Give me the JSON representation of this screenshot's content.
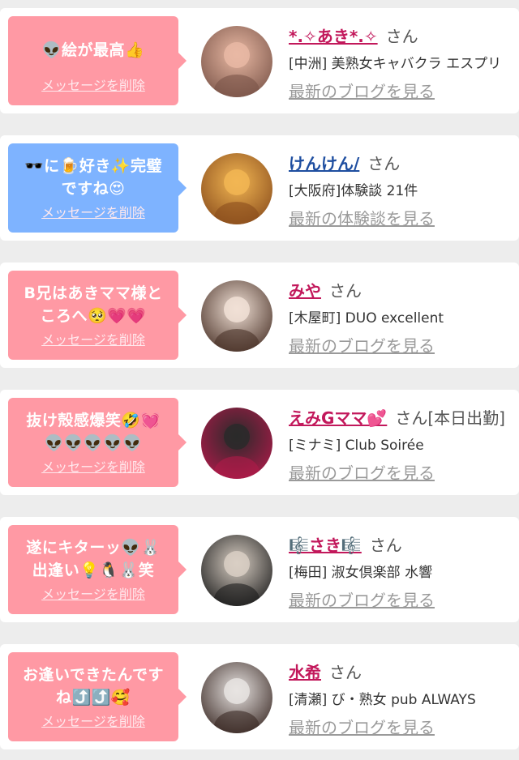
{
  "entries": [
    {
      "message": "👽絵が最高👍",
      "delete_label": "メッセージを削除",
      "bubble_color": "#ff99a4",
      "name": "*.✧あき*.✧",
      "name_color": "#c2185b",
      "honorific": "さん",
      "extra": "",
      "shop": "[中洲] 美熟女キャバクラ エスプリ",
      "see_link": "最新のブログを見る",
      "avatar_colors": [
        "#e9b9a4",
        "#7a5448"
      ]
    },
    {
      "message": "🕶️に🍺好き✨完璧\nですね😍",
      "delete_label": "メッセージを削除",
      "bubble_color": "#7eb3ff",
      "name": "けんけん/",
      "name_color": "#1e4ea0",
      "honorific": "さん",
      "extra": "",
      "shop": "[大阪府]体験談 21件",
      "see_link": "最新の体験談を見る",
      "avatar_colors": [
        "#f2b653",
        "#8a4d1c"
      ]
    },
    {
      "message": "B兄はあきママ様と\nころへ🥺💗💗",
      "delete_label": "メッセージを削除",
      "bubble_color": "#ff99a4",
      "name": "みや",
      "name_color": "#c2185b",
      "honorific": "さん",
      "extra": "",
      "shop": "[木屋町] DUO excellent",
      "see_link": "最新のブログを見る",
      "avatar_colors": [
        "#f1e1d6",
        "#4a3228"
      ]
    },
    {
      "message": "抜け殻感爆笑🤣💓\n👽👽👽👽👽",
      "delete_label": "メッセージを削除",
      "bubble_color": "#ff99a4",
      "name": "えみGママ💕",
      "name_color": "#c2185b",
      "honorific": "さん",
      "extra": "[本日出勤]",
      "shop": "[ミナミ] Club Soirée",
      "see_link": "最新のブログを見る",
      "avatar_colors": [
        "#2a2a2a",
        "#b01a4a"
      ]
    },
    {
      "message": "遂にキターッ👽🐰\n出逢い💡🐧🐰笑",
      "delete_label": "メッセージを削除",
      "bubble_color": "#ff99a4",
      "name": "🎼さき🎼",
      "name_color": "#c2185b",
      "honorific": "さん",
      "extra": "",
      "shop": "[梅田] 淑女倶楽部 水響",
      "see_link": "最新のブログを見る",
      "avatar_colors": [
        "#d9cfc4",
        "#1c1c1c"
      ]
    },
    {
      "message": "お逢いできたんです\nね⤴️⤴️🥰",
      "delete_label": "メッセージを削除",
      "bubble_color": "#ff99a4",
      "name": "水希",
      "name_color": "#c2185b",
      "honorific": "さん",
      "extra": "",
      "shop": "[清瀬] び・熟女 pub ALWAYS",
      "see_link": "最新のブログを見る",
      "avatar_colors": [
        "#e8e4e2",
        "#3b2a25"
      ]
    }
  ]
}
